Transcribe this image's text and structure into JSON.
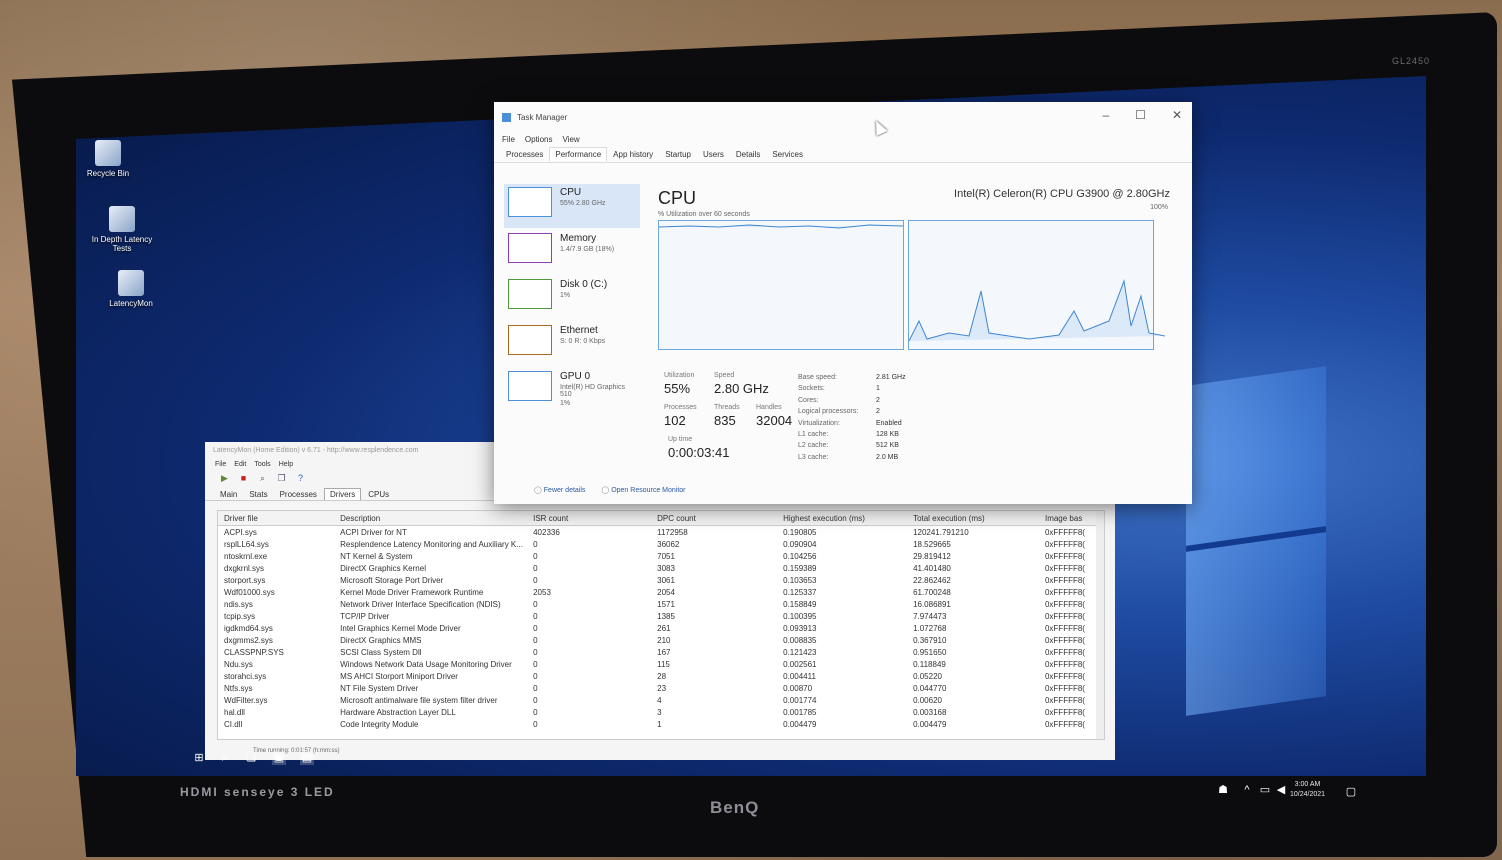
{
  "monitor": {
    "inputs_label": "HDMI  senseye 3  LED",
    "brand": "BenQ",
    "model": "GL2450"
  },
  "desktop_icons": [
    {
      "label": "Recycle Bin"
    },
    {
      "label": "In Depth Latency Tests"
    },
    {
      "label": "LatencyMon"
    }
  ],
  "task_manager": {
    "title": "Task Manager",
    "menu": [
      "File",
      "Options",
      "View"
    ],
    "tabs": [
      "Processes",
      "Performance",
      "App history",
      "Startup",
      "Users",
      "Details",
      "Services"
    ],
    "active_tab": "Performance",
    "sidebar": [
      {
        "name": "CPU",
        "sub": "55%  2.80 GHz"
      },
      {
        "name": "Memory",
        "sub": "1.4/7.9 GB (18%)"
      },
      {
        "name": "Disk 0 (C:)",
        "sub": "1%"
      },
      {
        "name": "Ethernet",
        "sub": "S: 0  R: 0 Kbps"
      },
      {
        "name": "GPU 0",
        "sub": "Intel(R) HD Graphics 510",
        "sub2": "1%"
      }
    ],
    "cpu": {
      "title": "CPU",
      "model": "Intel(R) Celeron(R) CPU G3900 @ 2.80GHz",
      "util_label": "% Utilization over 60 seconds",
      "pct_max": "100%",
      "utilization_label": "Utilization",
      "utilization": "55%",
      "speed_label": "Speed",
      "speed": "2.80 GHz",
      "processes_label": "Processes",
      "processes": "102",
      "threads_label": "Threads",
      "threads": "835",
      "handles_label": "Handles",
      "handles": "32004",
      "uptime_label": "Up time",
      "uptime": "0:00:03:41",
      "details": [
        {
          "k": "Base speed:",
          "v": "2.81 GHz"
        },
        {
          "k": "Sockets:",
          "v": "1"
        },
        {
          "k": "Cores:",
          "v": "2"
        },
        {
          "k": "Logical processors:",
          "v": "2"
        },
        {
          "k": "Virtualization:",
          "v": "Enabled"
        },
        {
          "k": "L1 cache:",
          "v": "128 KB"
        },
        {
          "k": "L2 cache:",
          "v": "512 KB"
        },
        {
          "k": "L3 cache:",
          "v": "2.0 MB"
        }
      ]
    },
    "footer": {
      "fewer": "Fewer details",
      "resmon": "Open Resource Monitor"
    }
  },
  "latencymon": {
    "title": "LatencyMon (Home Edition) v 6.71 - http://www.resplendence.com",
    "menu": [
      "File",
      "Edit",
      "Tools",
      "Help"
    ],
    "tabs": [
      "Main",
      "Stats",
      "Processes",
      "Drivers",
      "CPUs"
    ],
    "active_tab": "Drivers",
    "columns": [
      "Driver file",
      "Description",
      "ISR count",
      "DPC count",
      "Highest execution (ms)",
      "Total execution (ms)",
      "Image bas"
    ],
    "rows": [
      [
        "ACPI.sys",
        "ACPI Driver for NT",
        "402336",
        "1172958",
        "0.190805",
        "120241.791210",
        "0xFFFFF8("
      ],
      [
        "rsplLL64.sys",
        "Resplendence Latency Monitoring and Auxiliary K...",
        "0",
        "36062",
        "0.090904",
        "18.529665",
        "0xFFFFF8("
      ],
      [
        "ntoskrnl.exe",
        "NT Kernel & System",
        "0",
        "7051",
        "0.104256",
        "29.819412",
        "0xFFFFF8("
      ],
      [
        "dxgkrnl.sys",
        "DirectX Graphics Kernel",
        "0",
        "3083",
        "0.159389",
        "41.401480",
        "0xFFFFF8("
      ],
      [
        "storport.sys",
        "Microsoft Storage Port Driver",
        "0",
        "3061",
        "0.103653",
        "22.862462",
        "0xFFFFF8("
      ],
      [
        "Wdf01000.sys",
        "Kernel Mode Driver Framework Runtime",
        "2053",
        "2054",
        "0.125337",
        "61.700248",
        "0xFFFFF8("
      ],
      [
        "ndis.sys",
        "Network Driver Interface Specification (NDIS)",
        "0",
        "1571",
        "0.158849",
        "16.086891",
        "0xFFFFF8("
      ],
      [
        "tcpip.sys",
        "TCP/IP Driver",
        "0",
        "1385",
        "0.100395",
        "7.974473",
        "0xFFFFF8("
      ],
      [
        "igdkmd64.sys",
        "Intel Graphics Kernel Mode Driver",
        "0",
        "261",
        "0.093913",
        "1.072768",
        "0xFFFFF8("
      ],
      [
        "dxgmms2.sys",
        "DirectX Graphics MMS",
        "0",
        "210",
        "0.008835",
        "0.367910",
        "0xFFFFF8("
      ],
      [
        "CLASSPNP.SYS",
        "SCSI Class System Dll",
        "0",
        "167",
        "0.121423",
        "0.951650",
        "0xFFFFF8("
      ],
      [
        "Ndu.sys",
        "Windows Network Data Usage Monitoring Driver",
        "0",
        "115",
        "0.002561",
        "0.118849",
        "0xFFFFF8("
      ],
      [
        "storahci.sys",
        "MS AHCI Storport Miniport Driver",
        "0",
        "28",
        "0.004411",
        "0.05220",
        "0xFFFFF8("
      ],
      [
        "Ntfs.sys",
        "NT File System Driver",
        "0",
        "23",
        "0.00870",
        "0.044770",
        "0xFFFFF8("
      ],
      [
        "WdFilter.sys",
        "Microsoft antimalware file system filter driver",
        "0",
        "4",
        "0.001774",
        "0.00620",
        "0xFFFFF8("
      ],
      [
        "hal.dll",
        "Hardware Abstraction Layer DLL",
        "0",
        "3",
        "0.001785",
        "0.003168",
        "0xFFFFF8("
      ],
      [
        "CI.dll",
        "Code Integrity Module",
        "0",
        "1",
        "0.004479",
        "0.004479",
        "0xFFFFF8("
      ]
    ],
    "status": "Time running: 0:01:57  (h:mm:ss)"
  },
  "taskbar": {
    "time": "3:00 AM",
    "date": "10/24/2021"
  }
}
